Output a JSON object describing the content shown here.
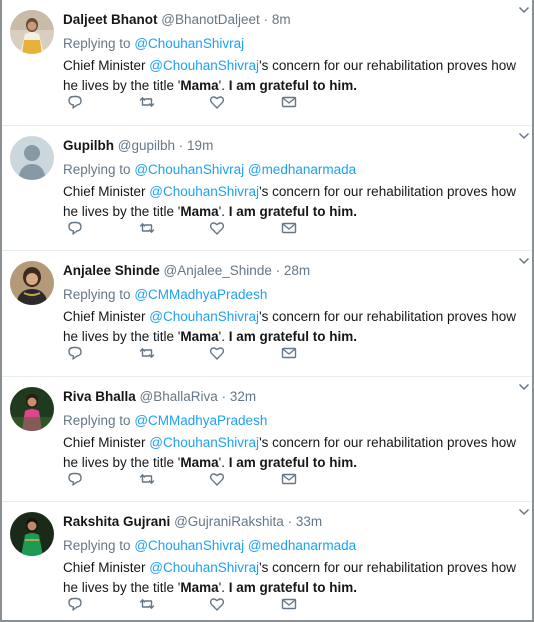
{
  "tweets": [
    {
      "name": "Daljeet Bhanot",
      "handle": "@BhanotDaljeet",
      "dot": "·",
      "time": "8m",
      "replying_prefix": "Replying to",
      "mentions": [
        "@ChouhanShivraj"
      ],
      "text_pre": "Chief Minister ",
      "text_mention": "@ChouhanShivraj",
      "text_mid": "'s concern for our rehabilitation proves how he lives by the title '",
      "text_bold1": "Mama",
      "text_mid2": "'. ",
      "text_bold2": "I am grateful to him",
      "text_end": ".",
      "avatar": "woman-traditional-dress-avatar"
    },
    {
      "name": "Gupilbh",
      "handle": "@gupilbh",
      "dot": "·",
      "time": "19m",
      "replying_prefix": "Replying to",
      "mentions": [
        "@ChouhanShivraj",
        "@medhanarmada"
      ],
      "text_pre": "Chief Minister ",
      "text_mention": "@ChouhanShivraj",
      "text_mid": "'s concern for our rehabilitation proves how he lives by the title '",
      "text_bold1": "Mama",
      "text_mid2": "'. ",
      "text_bold2": "I am grateful to him",
      "text_end": ".",
      "avatar": "default-silhouette-avatar"
    },
    {
      "name": "Anjalee Shinde",
      "handle": "@Anjalee_Shinde",
      "dot": "·",
      "time": "28m",
      "replying_prefix": "Replying to",
      "mentions": [
        "@CMMadhyaPradesh"
      ],
      "text_pre": "Chief Minister ",
      "text_mention": "@ChouhanShivraj",
      "text_mid": "'s concern for our rehabilitation proves how he lives by the title '",
      "text_bold1": "Mama",
      "text_mid2": "'. ",
      "text_bold2": "I am grateful to him",
      "text_end": ".",
      "avatar": "woman-portrait-avatar"
    },
    {
      "name": "Riva Bhalla",
      "handle": "@BhallaRiva",
      "dot": "·",
      "time": "32m",
      "replying_prefix": "Replying to",
      "mentions": [
        "@CMMadhyaPradesh"
      ],
      "text_pre": "Chief Minister ",
      "text_mention": "@ChouhanShivraj",
      "text_mid": "'s concern for our rehabilitation proves how he lives by the title '",
      "text_bold1": "Mama",
      "text_mid2": "'. ",
      "text_bold2": "I am grateful to him",
      "text_end": ".",
      "avatar": "woman-pink-dress-avatar"
    },
    {
      "name": "Rakshita Gujrani",
      "handle": "@GujraniRakshita",
      "dot": "·",
      "time": "33m",
      "replying_prefix": "Replying to",
      "mentions": [
        "@ChouhanShivraj",
        "@medhanarmada"
      ],
      "text_pre": "Chief Minister ",
      "text_mention": "@ChouhanShivraj",
      "text_mid": "'s concern for our rehabilitation proves how he lives by the title '",
      "text_bold1": "Mama",
      "text_mid2": "'. ",
      "text_bold2": "I am grateful to him",
      "text_end": ".",
      "avatar": "woman-green-dress-avatar"
    }
  ],
  "colors": {
    "link": "#1da1f2",
    "muted": "#657786",
    "text": "#14171a",
    "divider": "#e6ecf0"
  }
}
